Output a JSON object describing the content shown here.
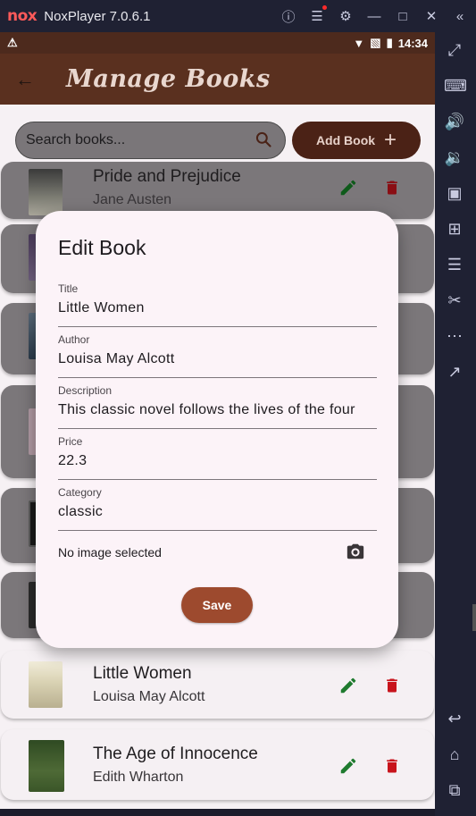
{
  "emulator": {
    "logo": "nox",
    "title": "NoxPlayer 7.0.6.1",
    "controls": [
      "help-icon",
      "menu-icon",
      "settings-icon",
      "minimize-icon",
      "maximize-icon",
      "close-icon",
      "collapse-icon"
    ]
  },
  "status_bar": {
    "time": "14:34"
  },
  "app_bar": {
    "title": "Manage Books"
  },
  "search": {
    "placeholder": "Search books..."
  },
  "add_button": {
    "label": "Add Book"
  },
  "books": [
    {
      "title": "Pride and Prejudice",
      "author": "Jane Austen"
    },
    {
      "title": "Little Women",
      "author": "Louisa May Alcott"
    },
    {
      "title": "The Age of Innocence",
      "author": "Edith Wharton"
    }
  ],
  "dialog": {
    "title": "Edit Book",
    "fields": [
      {
        "label": "Title",
        "value": "Little Women"
      },
      {
        "label": "Author",
        "value": "Louisa May Alcott"
      },
      {
        "label": "Description",
        "value": "This classic novel follows the lives of the four"
      },
      {
        "label": "Price",
        "value": "22.3"
      },
      {
        "label": "Category",
        "value": "classic"
      }
    ],
    "image_status": "No image selected",
    "save_label": "Save"
  },
  "colors": {
    "app_bar": "#5a301f",
    "accent": "#9d4a2e",
    "edit_icon": "#1e7a2e",
    "delete_icon": "#c8141c",
    "dialog_bg": "#fcf3f8"
  }
}
